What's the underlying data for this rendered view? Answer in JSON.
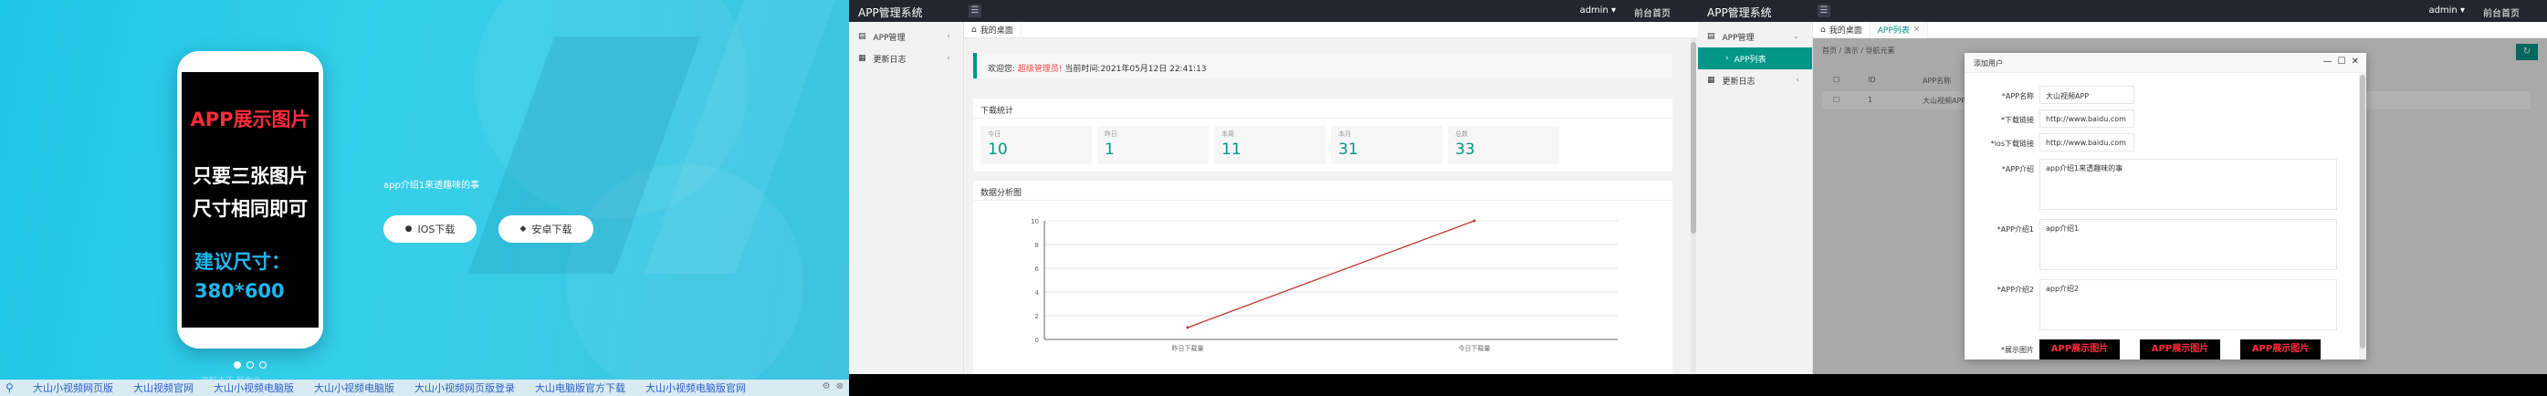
{
  "landing": {
    "phone_lines": {
      "title": "APP展示图片",
      "line1": "只要三张图片",
      "line2": "尺寸相同即可",
      "hint": "建议尺寸：",
      "size": "380*600"
    },
    "intro": "app介绍1来透趣味的事",
    "ios_button": "IOS下载",
    "android_button": "安卓下载",
    "carousel_caption": "资料未下 新作业",
    "taskbar_links": [
      "大山小视频网页版",
      "大山视频官网",
      "大山小视频电脑版",
      "大山小视频电脑版",
      "大山小视频网页版登录",
      "大山电脑版官方下载",
      "大山小视频电脑版官网"
    ],
    "colors": {
      "bg": "#2ccbe8",
      "title_red": "#ff2c3a",
      "hint_blue": "#1fb6f0"
    }
  },
  "admin": {
    "title": "APP管理系统",
    "user": "admin",
    "home_link": "前台首页",
    "sidebar": {
      "app_manage": "APP管理",
      "update_log": "更新日志",
      "app_list": "APP列表"
    },
    "tabs": {
      "desk": "我的桌面",
      "app_list": "APP列表"
    },
    "accent": "#009688"
  },
  "dashboard": {
    "welcome_label": "欢迎您:",
    "welcome_user": "超级管理员!",
    "welcome_time": "当前时间:2021年05月12日 22:41:13",
    "downloads_title": "下载统计",
    "stats": [
      {
        "label": "今日",
        "value": "10"
      },
      {
        "label": "昨日",
        "value": "1"
      },
      {
        "label": "本周",
        "value": "11"
      },
      {
        "label": "本月",
        "value": "31"
      },
      {
        "label": "总数",
        "value": "33"
      }
    ],
    "analysis_title": "数据分析图"
  },
  "chart_data": {
    "type": "line",
    "categories": [
      "昨日下载量",
      "今日下载量"
    ],
    "series": [
      {
        "values": [
          1,
          10
        ]
      }
    ],
    "ylim": [
      0,
      10
    ],
    "yticks": [
      "0",
      "2",
      "4",
      "6",
      "8",
      "10"
    ],
    "grid": true,
    "line_color": "#c23531"
  },
  "applist": {
    "breadcrumb": "首页 / 演示 / 导航元素",
    "col_id": "ID",
    "col_name": "APP名称",
    "row_id": "1",
    "row_name": "大山视频APP"
  },
  "modal": {
    "title": "添加用户",
    "fields": {
      "name_label": "*APP名称",
      "name_value": "大山视频APP",
      "download_label": "*下载链接",
      "download_value": "http://www.baidu.com",
      "ios_label": "*ios下载链接",
      "ios_value": "http://www.baidu.com",
      "intro_label": "*APP介绍",
      "intro_value": "app介绍1来透趣味的事",
      "intro1_label": "*APP介绍1",
      "intro1_value": "app介绍1",
      "intro2_label": "*APP介绍2",
      "intro2_value": "app介绍2",
      "images_label": "*展示图片"
    },
    "thumb_text": "APP展示图片",
    "controls": {
      "min": "—",
      "max": "☐",
      "close": "✕"
    }
  }
}
